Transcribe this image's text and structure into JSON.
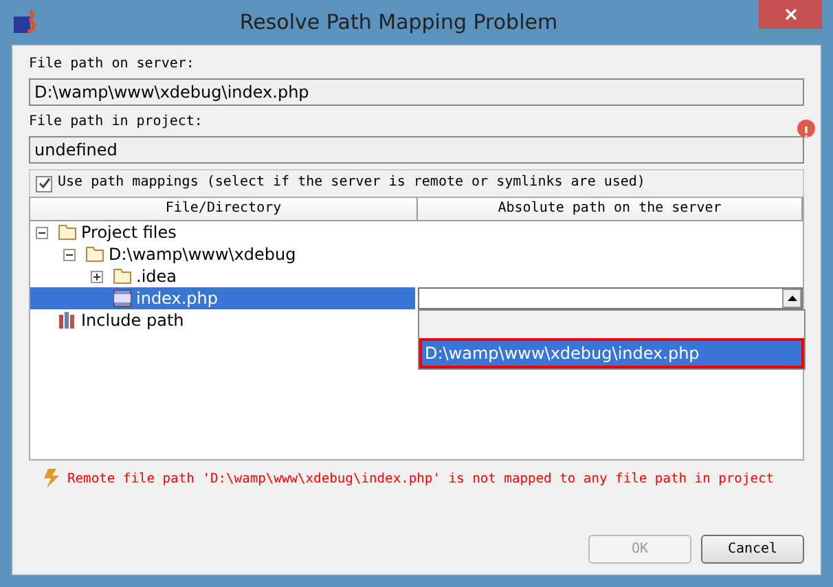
{
  "window": {
    "title": "Resolve Path Mapping Problem"
  },
  "server_path": {
    "label": "File path on server:",
    "value": "D:\\wamp\\www\\xdebug\\index.php"
  },
  "project_path": {
    "label": "File path in project:",
    "value": "undefined",
    "error": true
  },
  "use_mappings": {
    "label": "Use path mappings (select if the server is remote or symlinks are used)",
    "checked": true
  },
  "table": {
    "columns": [
      "File/Directory",
      "Absolute path on the server"
    ],
    "rows": [
      {
        "label": "Project files",
        "kind": "folder",
        "expanded": true,
        "selected": false,
        "children": [
          {
            "label": "D:\\wamp\\www\\xdebug",
            "kind": "folder",
            "expanded": true,
            "selected": false,
            "children": [
              {
                "label": ".idea",
                "kind": "folder",
                "expanded": false,
                "selected": false
              },
              {
                "label": "index.php",
                "kind": "php",
                "selected": true,
                "editing": true
              }
            ]
          }
        ]
      },
      {
        "label": "Include path",
        "kind": "library",
        "selected": false
      }
    ]
  },
  "dropdown": {
    "options": [
      {
        "selected": false
      },
      {
        "label": "D:\\wamp\\www\\xdebug\\index.php",
        "selected": true
      }
    ]
  },
  "error_message": "Remote file path 'D:\\wamp\\www\\xdebug\\index.php' is not mapped to any file path in project",
  "buttons": [
    {
      "label": "OK",
      "disabled": true
    },
    {
      "label": "Cancel",
      "disabled": false
    }
  ]
}
